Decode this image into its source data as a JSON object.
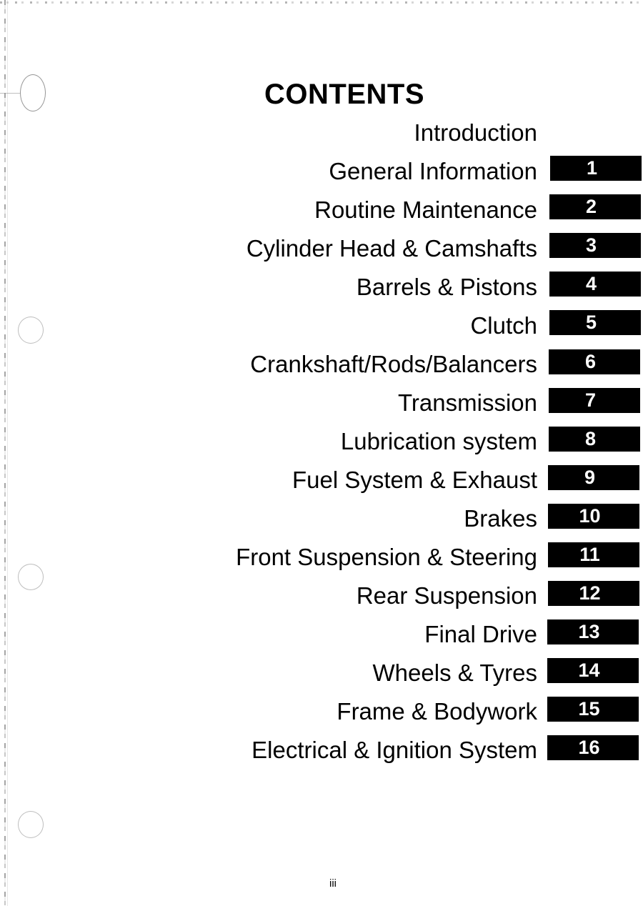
{
  "page": {
    "heading": "CONTENTS",
    "page_number": "iii"
  },
  "contents": {
    "entries": [
      {
        "label": "Introduction",
        "tab": "",
        "has_tab": false
      },
      {
        "label": "General Information",
        "tab": "1",
        "has_tab": true
      },
      {
        "label": "Routine Maintenance",
        "tab": "2",
        "has_tab": true
      },
      {
        "label": "Cylinder Head & Camshafts",
        "tab": "3",
        "has_tab": true
      },
      {
        "label": "Barrels & Pistons",
        "tab": "4",
        "has_tab": true
      },
      {
        "label": "Clutch",
        "tab": "5",
        "has_tab": true
      },
      {
        "label": "Crankshaft/Rods/Balancers",
        "tab": "6",
        "has_tab": true
      },
      {
        "label": "Transmission",
        "tab": "7",
        "has_tab": true
      },
      {
        "label": "Lubrication system",
        "tab": "8",
        "has_tab": true
      },
      {
        "label": "Fuel System & Exhaust",
        "tab": "9",
        "has_tab": true
      },
      {
        "label": "Brakes",
        "tab": "10",
        "has_tab": true
      },
      {
        "label": "Front Suspension & Steering",
        "tab": "11",
        "has_tab": true
      },
      {
        "label": "Rear Suspension",
        "tab": "12",
        "has_tab": true
      },
      {
        "label": "Final Drive",
        "tab": "13",
        "has_tab": true
      },
      {
        "label": "Wheels & Tyres",
        "tab": "14",
        "has_tab": true
      },
      {
        "label": "Frame & Bodywork",
        "tab": "15",
        "has_tab": true
      },
      {
        "label": "Electrical & Ignition System",
        "tab": "16",
        "has_tab": true
      }
    ]
  },
  "colors": {
    "tab_background": "#000000",
    "tab_number": "#ffffff",
    "text": "#000000",
    "paper": "#ffffff"
  }
}
